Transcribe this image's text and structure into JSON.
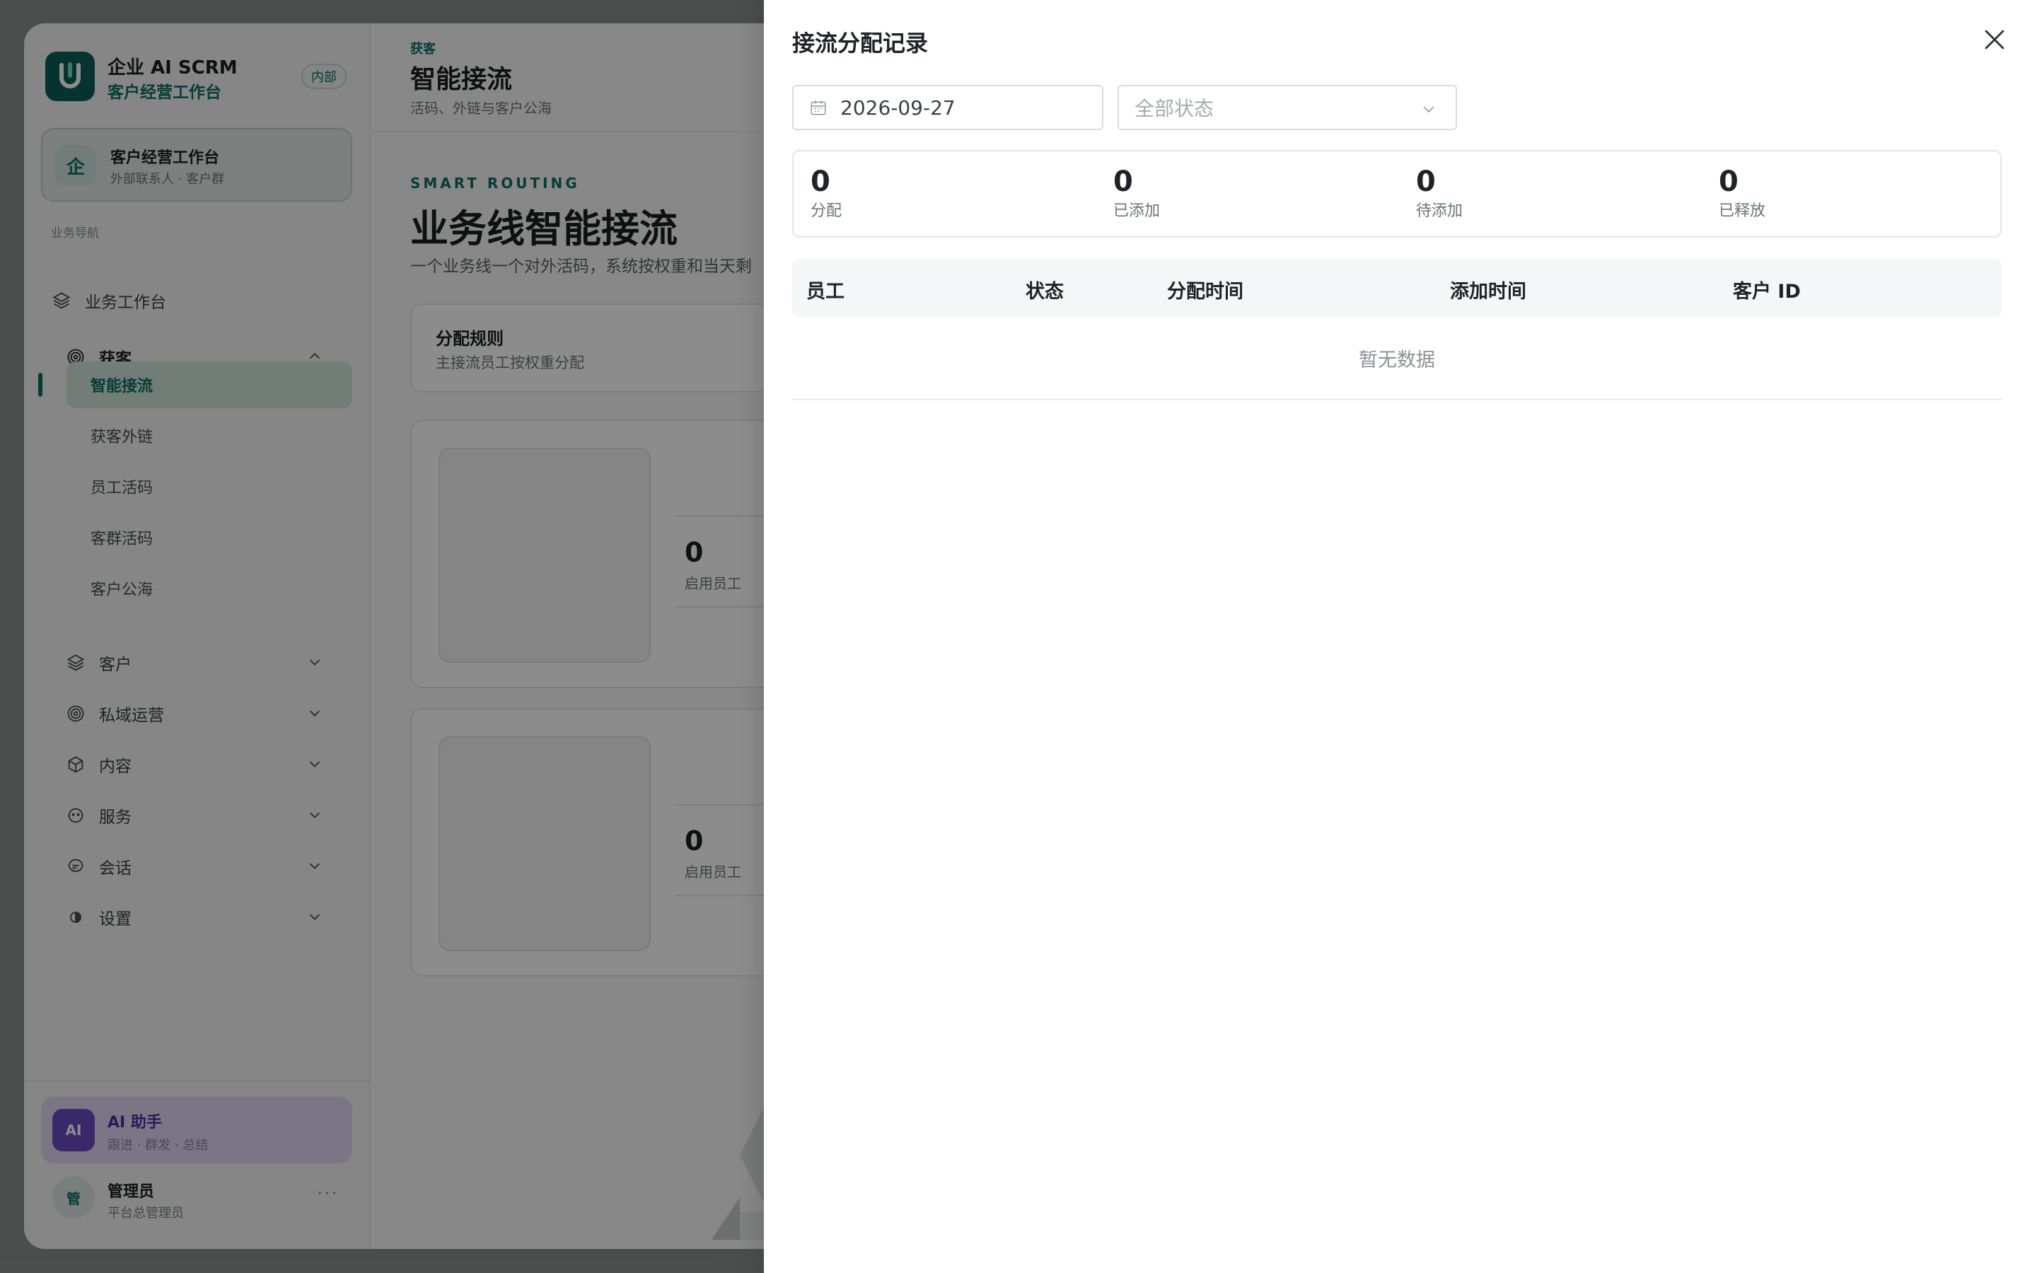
{
  "sidebar": {
    "brand_name": "企业 AI SCRM",
    "brand_sub": "客户经营工作台",
    "badge": "内部",
    "workspace": {
      "icon_char": "企",
      "title": "客户经营工作台",
      "subtitle": "外部联系人 · 客户群"
    },
    "nav_caption": "业务导航",
    "nav": {
      "workbench": "业务工作台",
      "acquire": "获客",
      "acquire_sub": [
        "智能接流",
        "获客外链",
        "员工活码",
        "客群活码",
        "客户公海"
      ],
      "customer": "客户",
      "private_ops": "私域运营",
      "content": "内容",
      "service": "服务",
      "session": "会话",
      "settings": "设置"
    },
    "ai": {
      "icon_text": "AI",
      "title": "AI 助手",
      "subtitle": "跟进 · 群发 · 总结"
    },
    "admin": {
      "avatar_char": "管",
      "name": "管理员",
      "role": "平台总管理员",
      "more": "···"
    }
  },
  "main": {
    "crumb": "获客",
    "title": "智能接流",
    "subtitle": "活码、外链与客户公海",
    "eyebrow": "SMART ROUTING",
    "hero_title": "业务线智能接流",
    "hero_desc": "一个业务线一个对外活码，系统按权重和当天剩",
    "rule_card": {
      "title": "分配规则",
      "subtitle": "主接流员工按权重分配"
    },
    "line_cards": [
      {
        "stat_value": "0",
        "stat_label": "启用员工"
      },
      {
        "stat_value": "0",
        "stat_label": "启用员工"
      }
    ]
  },
  "drawer": {
    "title": "接流分配记录",
    "date_value": "2026-09-27",
    "status_placeholder": "全部状态",
    "stats": [
      {
        "value": "0",
        "label": "分配"
      },
      {
        "value": "0",
        "label": "已添加"
      },
      {
        "value": "0",
        "label": "待添加"
      },
      {
        "value": "0",
        "label": "已释放"
      }
    ],
    "table": {
      "columns": [
        "员工",
        "状态",
        "分配时间",
        "添加时间",
        "客户 ID"
      ],
      "empty_text": "暂无数据"
    }
  },
  "colors": {
    "brand": "#0f6d65",
    "ai": "#6b4bc2",
    "overlay": "rgba(0,0,0,0.45)"
  },
  "icons": {
    "close": "close-icon",
    "calendar": "calendar-icon",
    "dropdown": "chevron-down-icon",
    "workbench": "layers-icon",
    "acquire": "target-icon",
    "customer": "layers-icon",
    "private_ops": "target-icon",
    "content": "box-icon",
    "service": "face-icon",
    "session": "chat-icon",
    "settings": "gear-icon"
  }
}
